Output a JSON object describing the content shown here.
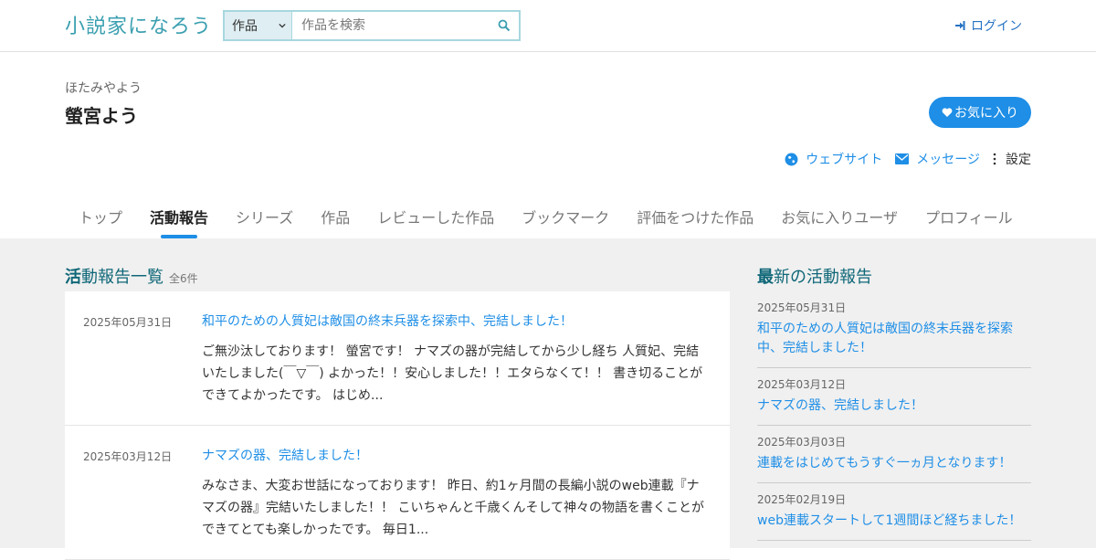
{
  "header": {
    "logo": "小説家になろう",
    "search_category": "作品",
    "search_placeholder": "作品を検索",
    "login_label": "ログイン"
  },
  "profile": {
    "kana": "ほたみやよう",
    "name": "螢宮よう",
    "favorite_label": "お気に入り",
    "website_label": "ウェブサイト",
    "message_label": "メッセージ",
    "settings_label": "設定"
  },
  "tabs": [
    {
      "label": "トップ",
      "active": false
    },
    {
      "label": "活動報告",
      "active": true
    },
    {
      "label": "シリーズ",
      "active": false
    },
    {
      "label": "作品",
      "active": false
    },
    {
      "label": "レビューした作品",
      "active": false
    },
    {
      "label": "ブックマーク",
      "active": false
    },
    {
      "label": "評価をつけた作品",
      "active": false
    },
    {
      "label": "お気に入りユーザ",
      "active": false
    },
    {
      "label": "プロフィール",
      "active": false
    }
  ],
  "reports": {
    "title_first": "活",
    "title_rest": "動報告一覧",
    "count": "全6件",
    "entries": [
      {
        "date": "2025年05月31日",
        "title": "和平のための人質妃は敵国の終末兵器を探索中、完結しました！",
        "text": "ご無沙汰しております！ 螢宮です！ ナマズの器が完結してから少し経ち 人質妃、完結いたしました(￣▽￣) よかった！！安心しました！！エタらなくて！！ 書き切ることができてよかったです。 はじめ..."
      },
      {
        "date": "2025年03月12日",
        "title": "ナマズの器、完結しました！",
        "text": "みなさま、大変お世話になっております！ 昨日、約1ヶ月間の長編小説のweb連載『ナマズの器』完結いたしました！！ こいちゃんと千歳くんそして神々の物語を書くことができてとても楽しかったです。 毎日1..."
      }
    ]
  },
  "sidebar": {
    "title_first": "最",
    "title_rest": "新の活動報告",
    "items": [
      {
        "date": "2025年05月31日",
        "title": "和平のための人質妃は敵国の終末兵器を探索中、完結しました！"
      },
      {
        "date": "2025年03月12日",
        "title": "ナマズの器、完結しました！"
      },
      {
        "date": "2025年03月03日",
        "title": "連載をはじめてもうすぐ一ヵ月となります！"
      },
      {
        "date": "2025年02月19日",
        "title": "web連載スタートして1週間ほど経ちました！"
      }
    ]
  },
  "colors": {
    "accent": "#1e8ee6",
    "heading": "#0f6778",
    "background": "#f0f0f0"
  }
}
